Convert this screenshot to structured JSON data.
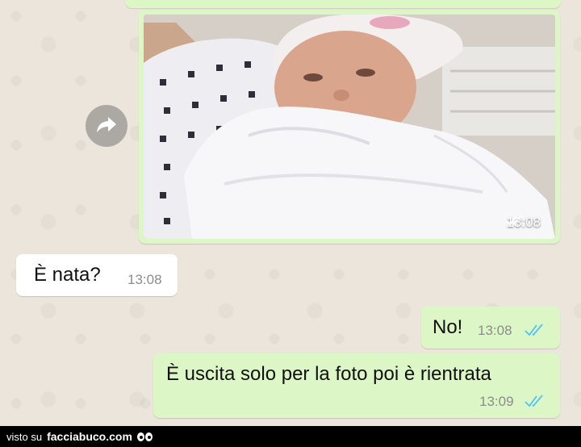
{
  "chat": {
    "photo_message": {
      "time": "13:08",
      "status": "read"
    },
    "messages": [
      {
        "direction": "incoming",
        "text": "È nata?",
        "time": "13:08"
      },
      {
        "direction": "outgoing",
        "text": "No!",
        "time": "13:08",
        "status": "read"
      },
      {
        "direction": "outgoing",
        "text": "È uscita solo per la foto poi è rientrata",
        "time": "13:09",
        "status": "read"
      }
    ],
    "forward_icon": "forward-arrow-icon"
  },
  "footer": {
    "prefix": "visto su",
    "brand": "facciabuco.com"
  },
  "colors": {
    "outgoing_bubble": "#dcf7c5",
    "incoming_bubble": "#ffffff",
    "read_ticks": "#4fc3f7",
    "chat_background": "#ece5dc"
  }
}
